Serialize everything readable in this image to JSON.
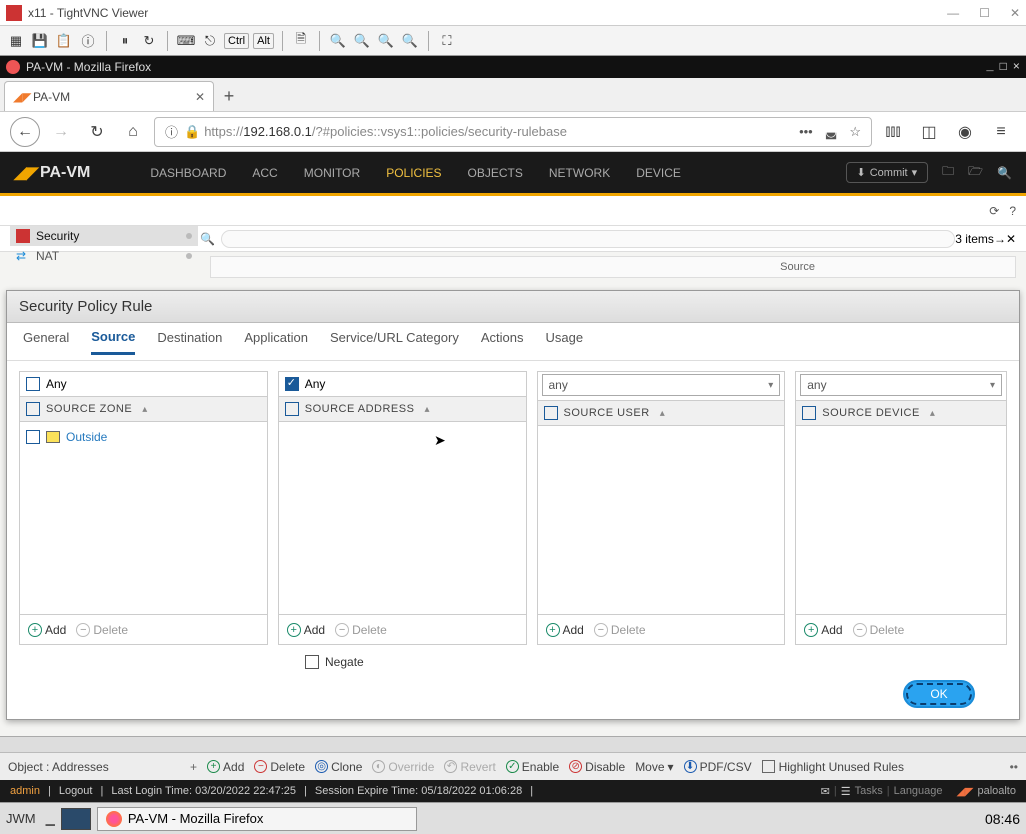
{
  "vnc": {
    "title": "x11 - TightVNC Viewer",
    "keys": {
      "ctrl": "Ctrl",
      "alt": "Alt"
    }
  },
  "firefox": {
    "window_title": "PA-VM - Mozilla Firefox",
    "tab_title": "PA-VM",
    "url_prefix": "https://",
    "url_host": "192.168.0.1",
    "url_path": "/?#policies::vsys1::policies/security-rulebase"
  },
  "pan": {
    "brand": "PA-VM",
    "menu": {
      "dashboard": "DASHBOARD",
      "acc": "ACC",
      "monitor": "MONITOR",
      "policies": "POLICIES",
      "objects": "OBJECTS",
      "network": "NETWORK",
      "device": "DEVICE"
    },
    "commit": "Commit",
    "item_count": "3 items",
    "sidebar": {
      "security": "Security",
      "nat": "NAT"
    },
    "source_hdr": "Source"
  },
  "dlg": {
    "title": "Security Policy Rule",
    "tabs": {
      "general": "General",
      "source": "Source",
      "destination": "Destination",
      "application": "Application",
      "service": "Service/URL Category",
      "actions": "Actions",
      "usage": "Usage"
    },
    "any": "Any",
    "headers": {
      "zone": "SOURCE ZONE",
      "address": "SOURCE ADDRESS",
      "user": "SOURCE USER",
      "device": "SOURCE DEVICE"
    },
    "zones": [
      {
        "name": "Outside"
      }
    ],
    "select_any": "any",
    "add": "Add",
    "delete": "Delete",
    "negate": "Negate",
    "ok": "OK"
  },
  "bottom": {
    "object": "Object : Addresses",
    "add": "Add",
    "delete": "Delete",
    "clone": "Clone",
    "override": "Override",
    "revert": "Revert",
    "enable": "Enable",
    "disable": "Disable",
    "move": "Move",
    "pdf": "PDF/CSV",
    "highlight": "Highlight Unused Rules"
  },
  "status": {
    "admin": "admin",
    "logout": "Logout",
    "last_login": "Last Login Time: 03/20/2022 22:47:25",
    "expire": "Session Expire Time: 05/18/2022 01:06:28",
    "tasks": "Tasks",
    "language": "Language",
    "brand": "paloalto"
  },
  "taskbar": {
    "jwm": "JWM",
    "task": "PA-VM - Mozilla Firefox",
    "clock": "08:46"
  }
}
